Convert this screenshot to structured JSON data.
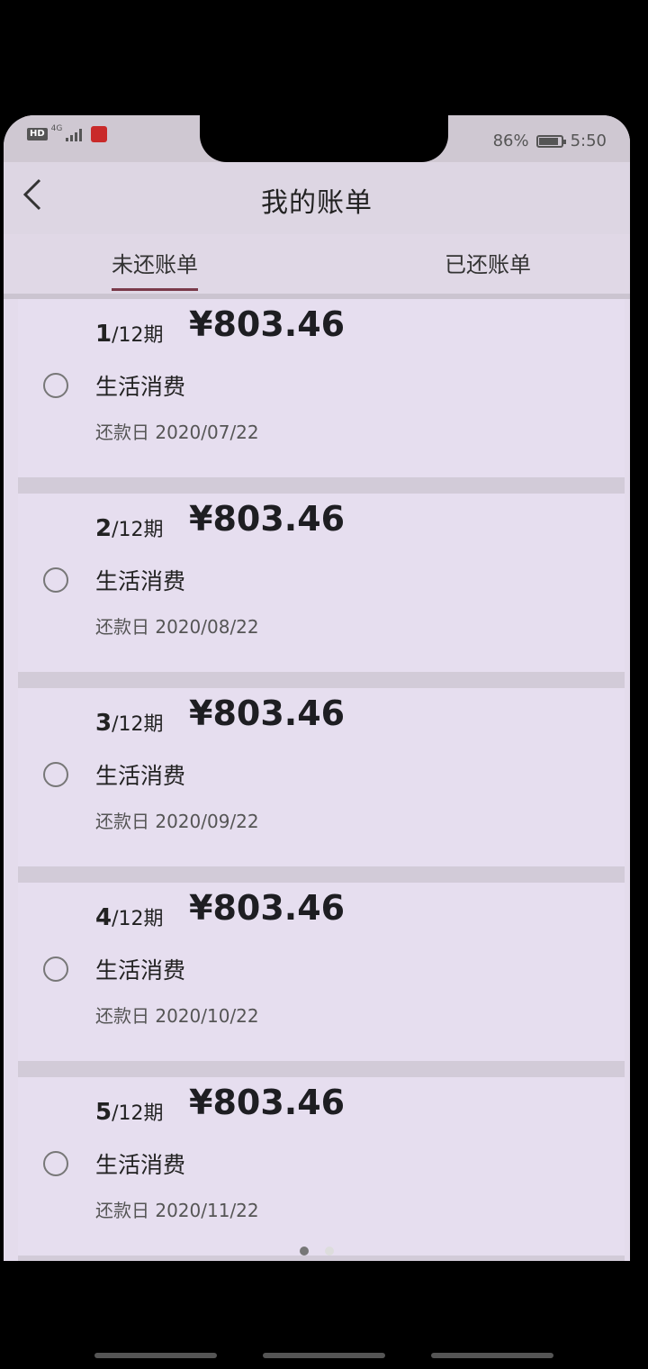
{
  "status_bar": {
    "left_label": "HD",
    "network": "4G",
    "battery": "86%",
    "time": "5:50"
  },
  "header": {
    "title": "我的账单"
  },
  "tabs": [
    {
      "label": "未还账单",
      "active": true
    },
    {
      "label": "已还账单",
      "active": false
    }
  ],
  "bills": [
    {
      "period_num": "1",
      "period_total": "/12期",
      "amount": "¥803.46",
      "category": "生活消费",
      "due": "还款日 2020/07/22"
    },
    {
      "period_num": "2",
      "period_total": "/12期",
      "amount": "¥803.46",
      "category": "生活消费",
      "due": "还款日 2020/08/22"
    },
    {
      "period_num": "3",
      "period_total": "/12期",
      "amount": "¥803.46",
      "category": "生活消费",
      "due": "还款日 2020/09/22"
    },
    {
      "period_num": "4",
      "period_total": "/12期",
      "amount": "¥803.46",
      "category": "生活消费",
      "due": "还款日 2020/10/22"
    },
    {
      "period_num": "5",
      "period_total": "/12期",
      "amount": "¥803.46",
      "category": "生活消费",
      "due": "还款日 2020/11/22"
    }
  ],
  "colors": {
    "accent": "#7a3a4a",
    "background": "#e4dcec"
  },
  "icons": {
    "back": "back-icon",
    "battery": "battery-icon",
    "signal": "signal-icon"
  }
}
